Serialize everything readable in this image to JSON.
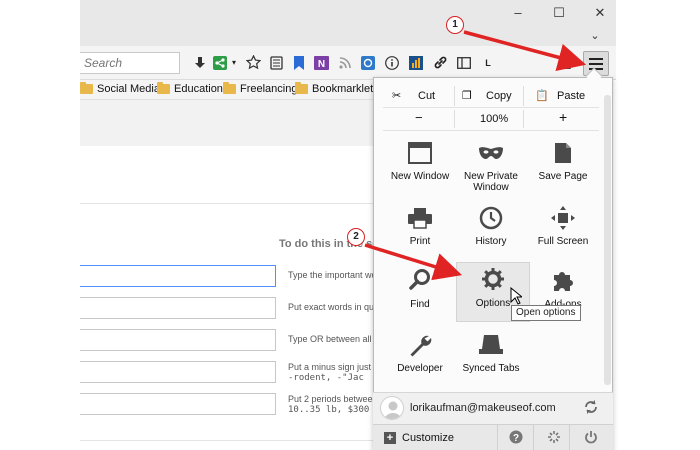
{
  "window": {
    "minimize_glyph": "–",
    "maximize_glyph": "☐",
    "close_glyph": "✕",
    "expand_glyph": "⌄"
  },
  "navbar": {
    "search_placeholder": "Search",
    "menu_glyph": "≡",
    "toolbar_icons": [
      "download-icon",
      "share-icon",
      "star-icon",
      "reading-list-icon",
      "bookmark-icon",
      "onenote-icon",
      "rss-icon",
      "pocket-icon",
      "info-icon",
      "chart-icon",
      "link-icon",
      "sidebar-icon",
      "l-icon",
      "clipboard-icon"
    ],
    "toolbar_l": "L"
  },
  "bookmarks": [
    "Social Media",
    "Education",
    "Freelancing",
    "Bookmarklets"
  ],
  "page": {
    "heading": "To do this in the se",
    "hints": [
      "Type the important wo",
      "Put exact words in qu",
      "Type OR between all t",
      "Put a minus sign just b",
      " -rodent, -\"Jac",
      "Put 2 periods between",
      "10..35 lb, $300"
    ]
  },
  "menu": {
    "edit": {
      "cut": "Cut",
      "copy": "Copy",
      "paste": "Paste"
    },
    "zoom": {
      "out": "−",
      "level": "100%",
      "in": "+"
    },
    "tiles": [
      {
        "label": "New Window"
      },
      {
        "label": "New Private Window"
      },
      {
        "label": "Save Page"
      },
      {
        "label": "Print"
      },
      {
        "label": "History"
      },
      {
        "label": "Full Screen"
      },
      {
        "label": "Find"
      },
      {
        "label": "Options"
      },
      {
        "label": "Add-ons"
      },
      {
        "label": "Developer"
      },
      {
        "label": "Synced Tabs"
      }
    ],
    "tooltip": "Open options",
    "account_email": "lorikaufman@makeuseof.com",
    "customize": "Customize"
  },
  "annotations": {
    "step1": "1",
    "step2": "2"
  },
  "colors": {
    "annotation_red": "#e02424",
    "folder": "#e8b94a",
    "panel_bg": "#fbfbfb"
  }
}
